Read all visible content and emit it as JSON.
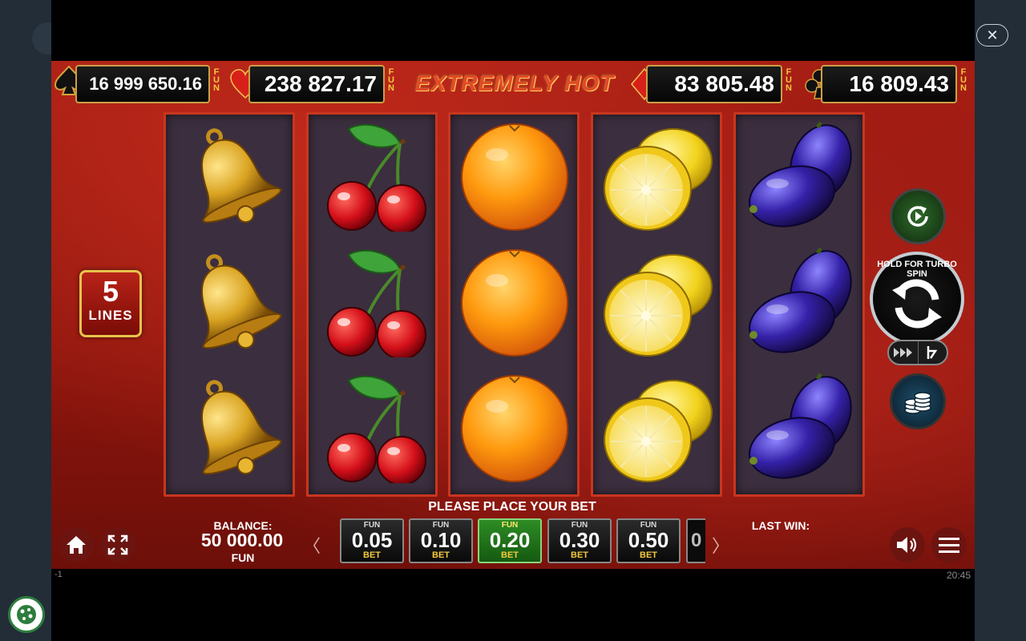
{
  "title": "EXTREMELY HOT",
  "close_icon_glyph": "✕",
  "jackpots": [
    {
      "suit": "spade-icon",
      "value": "16 999 650.16",
      "unit": "FUN"
    },
    {
      "suit": "heart-icon",
      "value": "238 827.17",
      "unit": "FUN"
    },
    {
      "suit": "diamond-icon",
      "value": "83 805.48",
      "unit": "FUN"
    },
    {
      "suit": "club-icon",
      "value": "16 809.43",
      "unit": "FUN"
    }
  ],
  "reels": [
    [
      "bell",
      "bell",
      "bell"
    ],
    [
      "cherries",
      "cherries",
      "cherries"
    ],
    [
      "orange",
      "orange",
      "orange"
    ],
    [
      "lemon",
      "lemon",
      "lemon"
    ],
    [
      "plum",
      "plum",
      "plum"
    ]
  ],
  "lines": {
    "count": "5",
    "label": "LINES"
  },
  "controls": {
    "spin_hint": "HOLD FOR TURBO SPIN",
    "autoplay_icon": "autoplay-icon",
    "spin_icon": "spin-icon",
    "fast_icon": "fast-forward-icon",
    "turbo_icon": "turbo-icon",
    "coins_icon": "coins-icon"
  },
  "bottom": {
    "prompt": "PLEASE PLACE YOUR BET",
    "balance_label": "BALANCE:",
    "balance_value": "50 000.00",
    "balance_unit": "FUN",
    "last_win_label": "LAST WIN:",
    "prev_arrow": "〈",
    "next_arrow": "〉",
    "partial_bet": "0",
    "bets": [
      {
        "top": "FUN",
        "value": "0.05",
        "sub": "BET",
        "selected": false
      },
      {
        "top": "FUN",
        "value": "0.10",
        "sub": "BET",
        "selected": false
      },
      {
        "top": "FUN",
        "value": "0.20",
        "sub": "BET",
        "selected": true
      },
      {
        "top": "FUN",
        "value": "0.30",
        "sub": "BET",
        "selected": false
      },
      {
        "top": "FUN",
        "value": "0.50",
        "sub": "BET",
        "selected": false
      }
    ]
  },
  "status": {
    "left": "-1",
    "time": "20:45"
  },
  "colors": {
    "selected_bet": "#2e8c25",
    "reel_border": "#c9361f",
    "jackpot_border": "#c9a046"
  }
}
